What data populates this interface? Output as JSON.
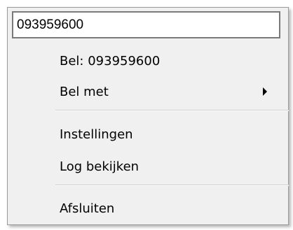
{
  "input": {
    "value": "093959600"
  },
  "menu": {
    "items": [
      {
        "label": "Bel: 093959600"
      },
      {
        "label": "Bel met",
        "submenu": true
      },
      {
        "label": "Instellingen"
      },
      {
        "label": "Log bekijken"
      },
      {
        "label": "Afsluiten"
      }
    ]
  },
  "colors": {
    "menu_background": "#f0f0f0",
    "input_border": "#7a7a7a",
    "separator": "#cfcfcf"
  }
}
